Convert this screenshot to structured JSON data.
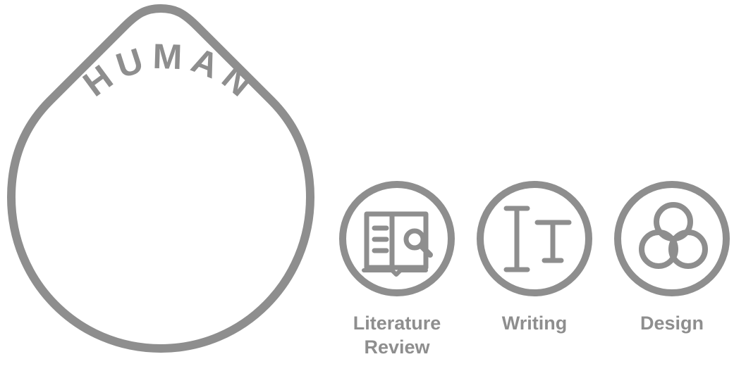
{
  "drop": {
    "label": "HUMAN"
  },
  "tools": [
    {
      "icon": "book-search-icon",
      "label_lines": [
        "Literature",
        "Review"
      ]
    },
    {
      "icon": "text-cursor-icon",
      "label_lines": [
        "Writing"
      ]
    },
    {
      "icon": "venn-circles-icon",
      "label_lines": [
        "Design"
      ]
    }
  ],
  "colors": {
    "stroke": "#8e8e8e",
    "text": "#8e8e8e",
    "background": "#ffffff"
  }
}
